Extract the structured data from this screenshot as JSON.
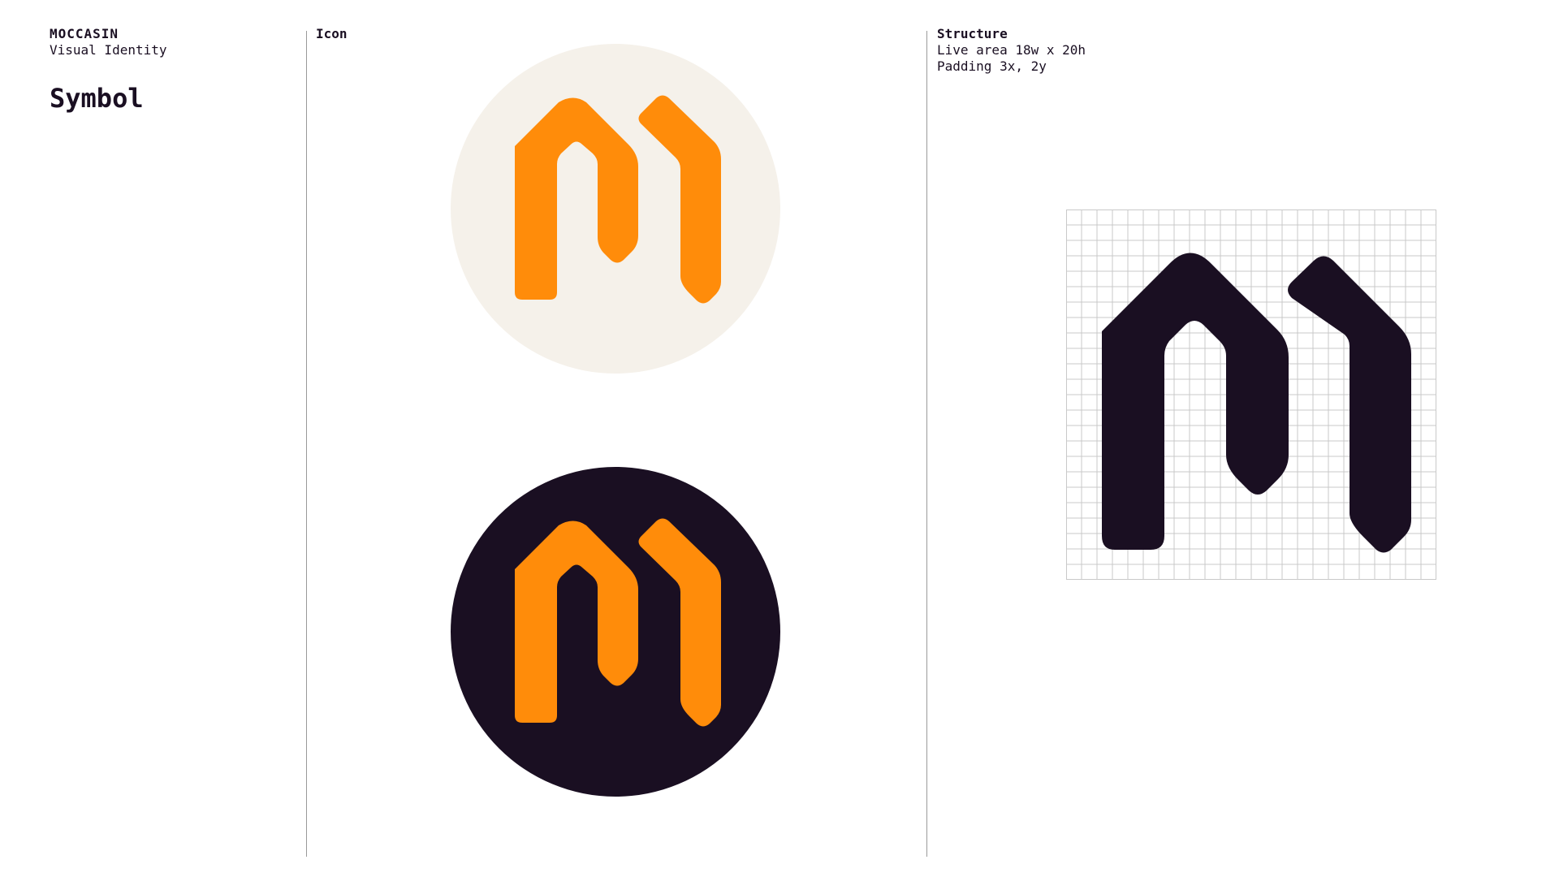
{
  "brand": {
    "name": "MOCCASIN",
    "subtitle": "Visual Identity",
    "section_title": "Symbol"
  },
  "icon_panel": {
    "label": "Icon"
  },
  "structure_panel": {
    "label": "Structure",
    "lines": [
      "Live area 18w x 20h",
      "Padding 3x, 2y"
    ]
  },
  "colors": {
    "orange": "#FF8C0A",
    "dark": "#1A0F22",
    "cream": "#F5F1EA",
    "grid": "#C9C9C9",
    "divider": "#9A9A9A"
  },
  "icons": {
    "light_badge": "moccasin-m-symbol",
    "dark_badge": "moccasin-m-symbol",
    "grid_symbol": "moccasin-m-symbol"
  }
}
